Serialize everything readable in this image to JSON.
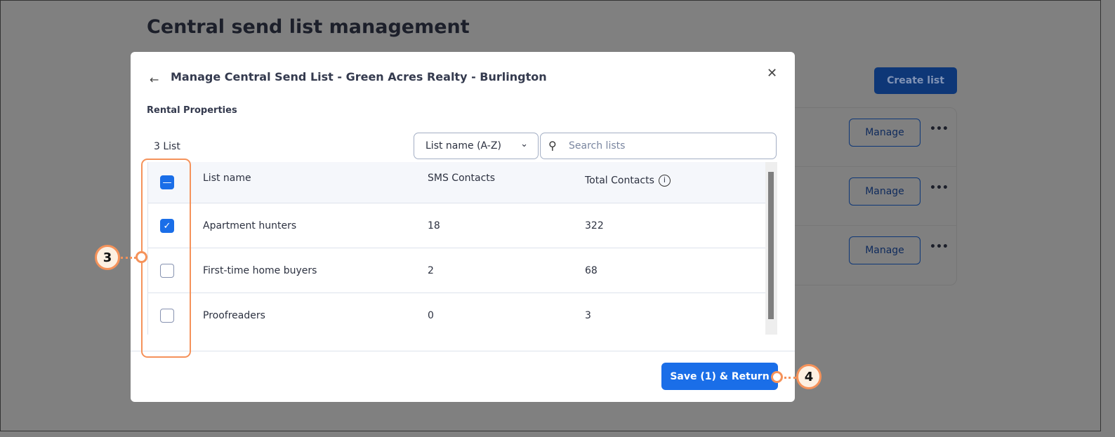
{
  "page": {
    "title": "Central send list management",
    "create_label": "Create list",
    "manage_label": "Manage",
    "more": "•••"
  },
  "modal": {
    "title": "Manage Central Send List - Green Acres Realty - Burlington",
    "subtitle": "Rental Properties",
    "count": "3 List",
    "sort": "List name (A-Z)",
    "search_placeholder": "Search lists",
    "save_label": "Save (1) & Return",
    "columns": [
      "List name",
      "SMS Contacts",
      "Total Contacts"
    ],
    "rows": [
      {
        "name": "Apartment hunters",
        "sms": "18",
        "total": "322",
        "checked": true
      },
      {
        "name": "First-time home buyers",
        "sms": "2",
        "total": "68",
        "checked": false
      },
      {
        "name": "Proofreaders",
        "sms": "0",
        "total": "3",
        "checked": false
      }
    ]
  },
  "annotations": {
    "step3": "3",
    "step4": "4"
  },
  "colors": {
    "accent": "#1a6ee8",
    "annotation": "#f5925a"
  }
}
